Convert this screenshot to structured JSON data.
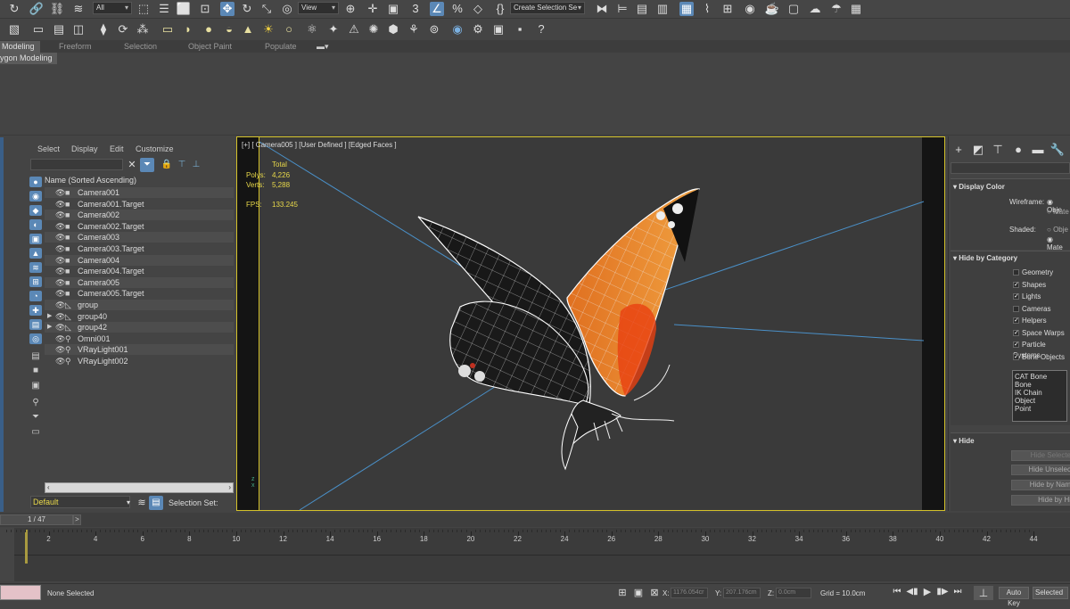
{
  "toolbar": {
    "filter_value": "All",
    "refcoord_value": "View",
    "selection_set_placeholder": "Create Selection Se"
  },
  "ribbon": {
    "tabs": [
      "Modeling",
      "Freeform",
      "Selection",
      "Object Paint",
      "Populate"
    ],
    "subtitle": "ygon Modeling"
  },
  "scene_explorer": {
    "menu": [
      "Select",
      "Display",
      "Edit",
      "Customize"
    ],
    "column_header": "Name (Sorted Ascending)",
    "items": [
      {
        "label": "Camera001",
        "kind": "camera"
      },
      {
        "label": "Camera001.Target",
        "kind": "camera"
      },
      {
        "label": "Camera002",
        "kind": "camera"
      },
      {
        "label": "Camera002.Target",
        "kind": "camera"
      },
      {
        "label": "Camera003",
        "kind": "camera"
      },
      {
        "label": "Camera003.Target",
        "kind": "camera"
      },
      {
        "label": "Camera004",
        "kind": "camera"
      },
      {
        "label": "Camera004.Target",
        "kind": "camera"
      },
      {
        "label": "Camera005",
        "kind": "camera"
      },
      {
        "label": "Camera005.Target",
        "kind": "camera"
      },
      {
        "label": "group",
        "kind": "group"
      },
      {
        "label": "group40",
        "kind": "group"
      },
      {
        "label": "group42",
        "kind": "group"
      },
      {
        "label": "Omni001",
        "kind": "light"
      },
      {
        "label": "VRayLight001",
        "kind": "light"
      },
      {
        "label": "VRayLight002",
        "kind": "light"
      }
    ],
    "layer_value": "Default",
    "selection_set_label": "Selection Set:"
  },
  "viewport": {
    "label": "[+] [ Camera005 ] [User Defined ] [Edged Faces ]",
    "stats": {
      "total_label": "Total",
      "polys_label": "Polys:",
      "polys_value": "4,226",
      "verts_label": "Verts:",
      "verts_value": "5,288",
      "fps_label": "FPS:",
      "fps_value": "133.245"
    }
  },
  "command_panel": {
    "display_color": {
      "header": "Display Color",
      "wireframe_label": "Wireframe:",
      "shaded_label": "Shaded:",
      "opt_object": "Obje",
      "opt_material": "Mate"
    },
    "hide_by_category": {
      "header": "Hide by Category",
      "items": [
        {
          "label": "Geometry",
          "checked": false
        },
        {
          "label": "Shapes",
          "checked": true
        },
        {
          "label": "Lights",
          "checked": true
        },
        {
          "label": "Cameras",
          "checked": false
        },
        {
          "label": "Helpers",
          "checked": true
        },
        {
          "label": "Space Warps",
          "checked": true
        },
        {
          "label": "Particle Systems",
          "checked": true
        },
        {
          "label": "Bone Objects",
          "checked": true
        }
      ],
      "list": [
        "CAT Bone",
        "Bone",
        "IK Chain Object",
        "Point"
      ]
    },
    "hide": {
      "header": "Hide",
      "buttons": [
        "Hide Selecte",
        "Hide Unselec",
        "Hide by Nam",
        "Hide by Hi"
      ]
    }
  },
  "timeline": {
    "frame_counter": "1 / 47",
    "ticks": [
      "2",
      "4",
      "6",
      "8",
      "10",
      "12",
      "14",
      "16",
      "18",
      "20",
      "22",
      "24",
      "26",
      "28",
      "30",
      "32",
      "34",
      "36",
      "38",
      "40",
      "42",
      "44"
    ]
  },
  "status": {
    "selection": "None Selected",
    "x_label": "X:",
    "x_value": "1176.054cr",
    "y_label": "Y:",
    "y_value": "207.176cm",
    "z_label": "Z:",
    "z_value": "0.0cm",
    "grid": "Grid = 10.0cm",
    "autokey": "Auto Key",
    "selected": "Selected"
  },
  "colors": {
    "accent": "#5b88b6",
    "viewport_border": "#d4c22a",
    "viewport_bg": "#3a3a3a",
    "stat_text": "#e8d84a"
  }
}
